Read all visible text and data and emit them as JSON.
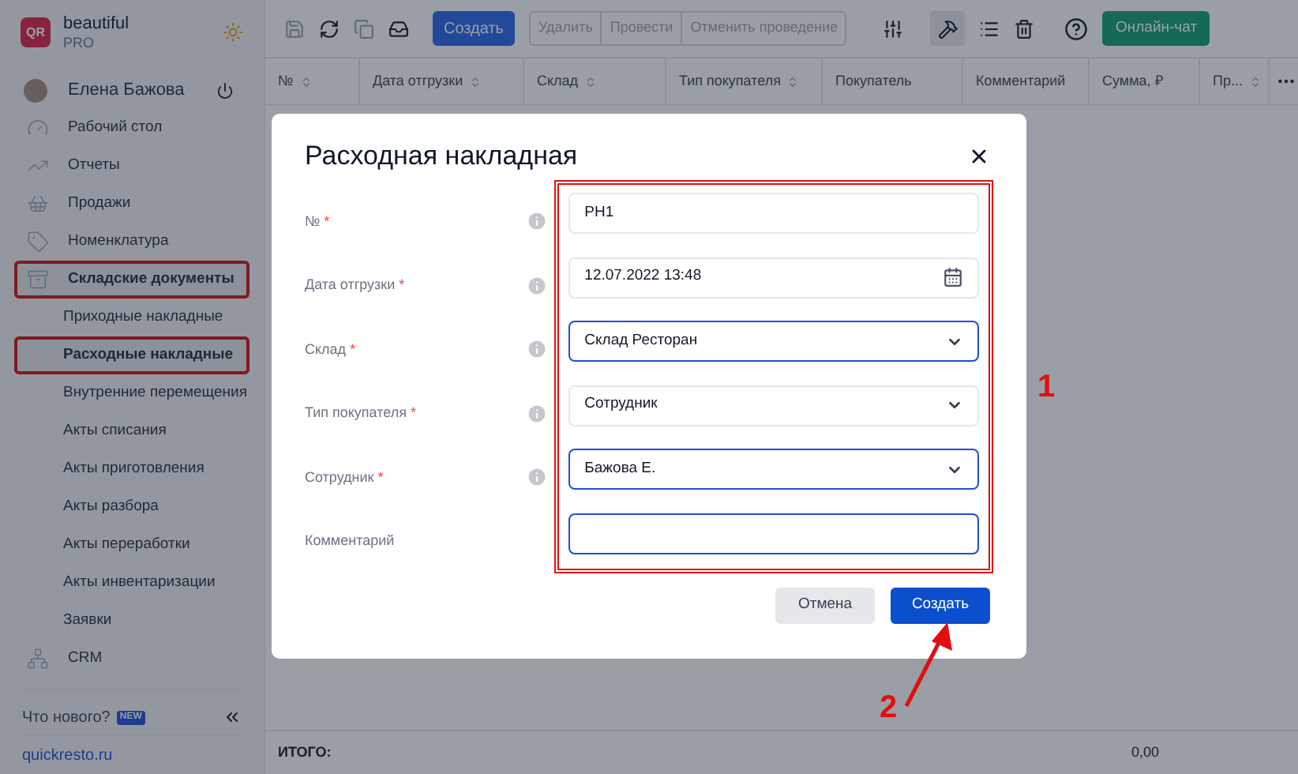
{
  "brand": {
    "name": "beautiful",
    "plan": "PRO",
    "logo": "QR"
  },
  "user": {
    "name": "Елена Бажова"
  },
  "sidebar": {
    "items": [
      {
        "label": "Рабочий стол",
        "selected": false,
        "highlighted": false
      },
      {
        "label": "Отчеты",
        "selected": false,
        "highlighted": false
      },
      {
        "label": "Продажи",
        "selected": false,
        "highlighted": false
      },
      {
        "label": "Номенклатура",
        "selected": false,
        "highlighted": false
      },
      {
        "label": "Складские документы",
        "selected": true,
        "highlighted": true,
        "children": [
          {
            "label": "Приходные накладные",
            "selected": false,
            "highlighted": false
          },
          {
            "label": "Расходные накладные",
            "selected": true,
            "highlighted": true
          },
          {
            "label": "Внутренние перемещения",
            "selected": false,
            "highlighted": false
          },
          {
            "label": "Акты списания",
            "selected": false,
            "highlighted": false
          },
          {
            "label": "Акты приготовления",
            "selected": false,
            "highlighted": false
          },
          {
            "label": "Акты разбора",
            "selected": false,
            "highlighted": false
          },
          {
            "label": "Акты переработки",
            "selected": false,
            "highlighted": false
          },
          {
            "label": "Акты инвентаризации",
            "selected": false,
            "highlighted": false
          },
          {
            "label": "Заявки",
            "selected": false,
            "highlighted": false
          }
        ]
      },
      {
        "label": "CRM",
        "selected": false,
        "highlighted": false
      }
    ],
    "whats_new": "Что нового?",
    "new_badge": "NEW",
    "site": "quickresto.ru"
  },
  "toolbar": {
    "create": "Создать",
    "actions": [
      {
        "label": "Удалить",
        "disabled": true
      },
      {
        "label": "Провести",
        "disabled": true
      },
      {
        "label": "Отменить проведение",
        "disabled": true
      }
    ],
    "chat": "Онлайн-чат"
  },
  "table": {
    "columns": [
      {
        "label": "№",
        "sortable": true
      },
      {
        "label": "Дата отгрузки",
        "sortable": true
      },
      {
        "label": "Склад",
        "sortable": true
      },
      {
        "label": "Тип покупателя",
        "sortable": true
      },
      {
        "label": "Покупатель",
        "sortable": false
      },
      {
        "label": "Комментарий",
        "sortable": false
      },
      {
        "label": "Сумма, ₽",
        "sortable": false
      },
      {
        "label": "Пр...",
        "sortable": true
      }
    ],
    "footer": {
      "label": "ИТОГО:",
      "sum": "0,00"
    }
  },
  "dialog": {
    "title": "Расходная накладная",
    "fields": [
      {
        "label": "№",
        "required_mark": "*",
        "info": true,
        "kind": "text",
        "value": "РН1",
        "focused": false
      },
      {
        "label": "Дата отгрузки",
        "required_mark": "*",
        "info": true,
        "kind": "date",
        "value": "12.07.2022 13:48",
        "focused": false
      },
      {
        "label": "Склад",
        "required_mark": "*",
        "info": true,
        "kind": "select",
        "value": "Склад Ресторан",
        "focused": true
      },
      {
        "label": "Тип покупателя",
        "required_mark": "*",
        "info": true,
        "kind": "select",
        "value": "Сотрудник",
        "focused": false
      },
      {
        "label": "Сотрудник",
        "required_mark": "*",
        "info": true,
        "kind": "select",
        "value": "Бажова Е.",
        "focused": true
      },
      {
        "label": "Комментарий",
        "info": false,
        "kind": "text",
        "focused": true
      }
    ],
    "cancel": "Отмена",
    "submit": "Создать"
  },
  "annotations": [
    {
      "label": "1"
    },
    {
      "label": "2"
    }
  ]
}
